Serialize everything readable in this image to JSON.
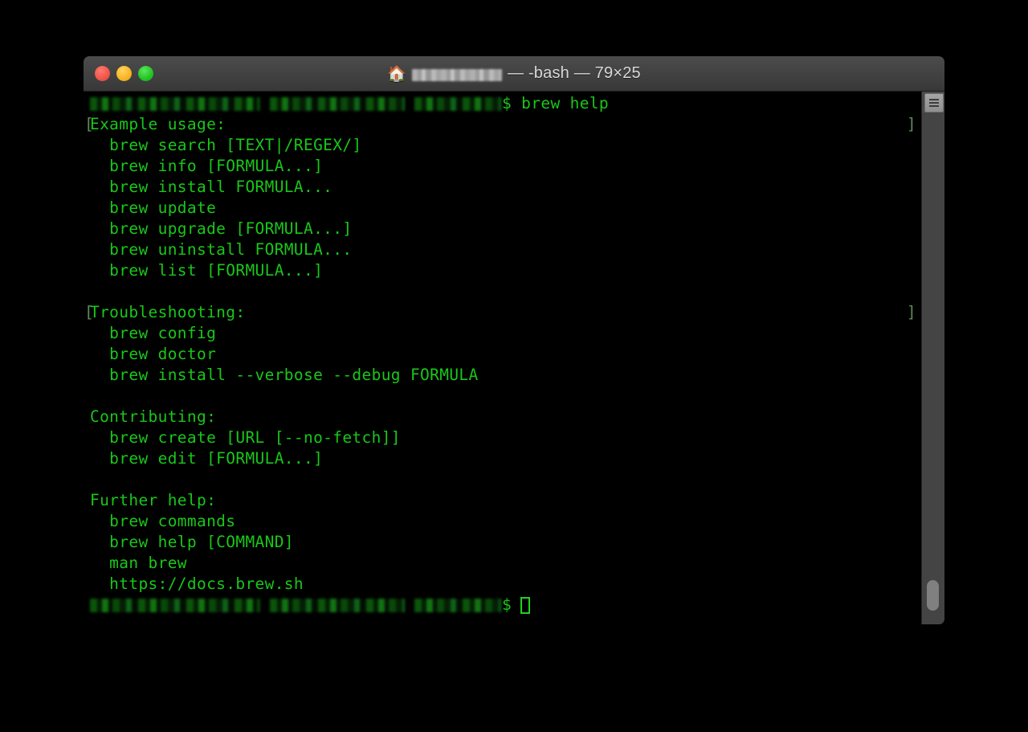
{
  "window": {
    "title_user_redacted": "",
    "title_suffix": "— -bash — 79×25",
    "home_icon": "🏠",
    "traffic_lights": {
      "close": "close-button",
      "minimize": "minimize-button",
      "zoom": "zoom-button"
    },
    "colors": {
      "titlebar": "#424242",
      "terminal_background": "#000000",
      "terminal_text": "#19c719",
      "bracket_match": "#5e8a5e",
      "cursor": "#1fd31f",
      "close_light": "#f0544a",
      "minimize_light": "#f7b322",
      "zoom_light": "#22c423"
    }
  },
  "terminal": {
    "command_line": {
      "prompt_redacted": true,
      "dollar": "$",
      "command": " brew help"
    },
    "lines": [
      {
        "text": "Example usage:",
        "bracket": true
      },
      {
        "text": "  brew search [TEXT|/REGEX/]",
        "bracket": false
      },
      {
        "text": "  brew info [FORMULA...]",
        "bracket": false
      },
      {
        "text": "  brew install FORMULA...",
        "bracket": false
      },
      {
        "text": "  brew update",
        "bracket": false
      },
      {
        "text": "  brew upgrade [FORMULA...]",
        "bracket": false
      },
      {
        "text": "  brew uninstall FORMULA...",
        "bracket": false
      },
      {
        "text": "  brew list [FORMULA...]",
        "bracket": false
      },
      {
        "text": "",
        "bracket": false
      },
      {
        "text": "Troubleshooting:",
        "bracket": true
      },
      {
        "text": "  brew config",
        "bracket": false
      },
      {
        "text": "  brew doctor",
        "bracket": false
      },
      {
        "text": "  brew install --verbose --debug FORMULA",
        "bracket": false
      },
      {
        "text": "",
        "bracket": false
      },
      {
        "text": "Contributing:",
        "bracket": false
      },
      {
        "text": "  brew create [URL [--no-fetch]]",
        "bracket": false
      },
      {
        "text": "  brew edit [FORMULA...]",
        "bracket": false
      },
      {
        "text": "",
        "bracket": false
      },
      {
        "text": "Further help:",
        "bracket": false
      },
      {
        "text": "  brew commands",
        "bracket": false
      },
      {
        "text": "  brew help [COMMAND]",
        "bracket": false
      },
      {
        "text": "  man brew",
        "bracket": false
      },
      {
        "text": "  https://docs.brew.sh",
        "bracket": false
      }
    ],
    "final_prompt": {
      "prompt_redacted": true,
      "dollar": "$",
      "cursor": "block-outline"
    }
  },
  "scrollbar": {
    "button_label": "scroll-options-button",
    "thumb_position": "bottom"
  }
}
